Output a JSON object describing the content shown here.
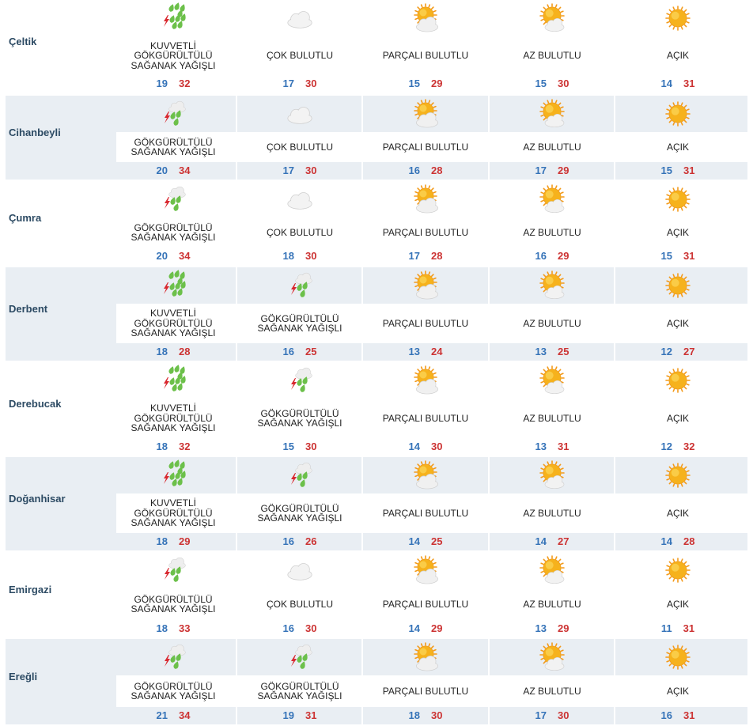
{
  "colors": {
    "row_shade": "#e9eef3",
    "city": "#2c4a63",
    "min_temp": "#3573b8",
    "max_temp": "#cc3333",
    "sun": "#f6b21c",
    "cloud": "#e7e7e7",
    "rain": "#6cc04a",
    "lightning": "#d9282f"
  },
  "rows": [
    {
      "city": "Çeltik",
      "shaded": false,
      "days": [
        {
          "icon": "strong-thunder-shower-icon",
          "condition": "KUVVETLİ GÖKGÜRÜLTÜLÜ SAĞANAK YAĞIŞLI",
          "min": "19",
          "max": "32"
        },
        {
          "icon": "cloudy-icon",
          "condition": "ÇOK BULUTLU",
          "min": "17",
          "max": "30"
        },
        {
          "icon": "partly-cloudy-icon",
          "condition": "PARÇALI BULUTLU",
          "min": "15",
          "max": "29"
        },
        {
          "icon": "mostly-sunny-icon",
          "condition": "AZ BULUTLU",
          "min": "15",
          "max": "30"
        },
        {
          "icon": "sunny-icon",
          "condition": "AÇIK",
          "min": "14",
          "max": "31"
        }
      ]
    },
    {
      "city": "Cihanbeyli",
      "shaded": true,
      "days": [
        {
          "icon": "thunder-shower-icon",
          "condition": "GÖKGÜRÜLTÜLÜ SAĞANAK YAĞIŞLI",
          "min": "20",
          "max": "34"
        },
        {
          "icon": "cloudy-icon",
          "condition": "ÇOK BULUTLU",
          "min": "17",
          "max": "30"
        },
        {
          "icon": "partly-cloudy-icon",
          "condition": "PARÇALI BULUTLU",
          "min": "16",
          "max": "28"
        },
        {
          "icon": "mostly-sunny-icon",
          "condition": "AZ BULUTLU",
          "min": "17",
          "max": "29"
        },
        {
          "icon": "sunny-icon",
          "condition": "AÇIK",
          "min": "15",
          "max": "31"
        }
      ]
    },
    {
      "city": "Çumra",
      "shaded": false,
      "days": [
        {
          "icon": "thunder-shower-icon",
          "condition": "GÖKGÜRÜLTÜLÜ SAĞANAK YAĞIŞLI",
          "min": "20",
          "max": "34"
        },
        {
          "icon": "cloudy-icon",
          "condition": "ÇOK BULUTLU",
          "min": "18",
          "max": "30"
        },
        {
          "icon": "partly-cloudy-icon",
          "condition": "PARÇALI BULUTLU",
          "min": "17",
          "max": "28"
        },
        {
          "icon": "mostly-sunny-icon",
          "condition": "AZ BULUTLU",
          "min": "16",
          "max": "29"
        },
        {
          "icon": "sunny-icon",
          "condition": "AÇIK",
          "min": "15",
          "max": "31"
        }
      ]
    },
    {
      "city": "Derbent",
      "shaded": true,
      "days": [
        {
          "icon": "strong-thunder-shower-icon",
          "condition": "KUVVETLİ GÖKGÜRÜLTÜLÜ SAĞANAK YAĞIŞLI",
          "min": "18",
          "max": "28"
        },
        {
          "icon": "thunder-shower-icon",
          "condition": "GÖKGÜRÜLTÜLÜ SAĞANAK YAĞIŞLI",
          "min": "16",
          "max": "25"
        },
        {
          "icon": "partly-cloudy-icon",
          "condition": "PARÇALI BULUTLU",
          "min": "13",
          "max": "24"
        },
        {
          "icon": "mostly-sunny-icon",
          "condition": "AZ BULUTLU",
          "min": "13",
          "max": "25"
        },
        {
          "icon": "sunny-icon",
          "condition": "AÇIK",
          "min": "12",
          "max": "27"
        }
      ]
    },
    {
      "city": "Derebucak",
      "shaded": false,
      "days": [
        {
          "icon": "strong-thunder-shower-icon",
          "condition": "KUVVETLİ GÖKGÜRÜLTÜLÜ SAĞANAK YAĞIŞLI",
          "min": "18",
          "max": "32"
        },
        {
          "icon": "thunder-shower-icon",
          "condition": "GÖKGÜRÜLTÜLÜ SAĞANAK YAĞIŞLI",
          "min": "15",
          "max": "30"
        },
        {
          "icon": "partly-cloudy-icon",
          "condition": "PARÇALI BULUTLU",
          "min": "14",
          "max": "30"
        },
        {
          "icon": "mostly-sunny-icon",
          "condition": "AZ BULUTLU",
          "min": "13",
          "max": "31"
        },
        {
          "icon": "sunny-icon",
          "condition": "AÇIK",
          "min": "12",
          "max": "32"
        }
      ]
    },
    {
      "city": "Doğanhisar",
      "shaded": true,
      "days": [
        {
          "icon": "strong-thunder-shower-icon",
          "condition": "KUVVETLİ GÖKGÜRÜLTÜLÜ SAĞANAK YAĞIŞLI",
          "min": "18",
          "max": "29"
        },
        {
          "icon": "thunder-shower-icon",
          "condition": "GÖKGÜRÜLTÜLÜ SAĞANAK YAĞIŞLI",
          "min": "16",
          "max": "26"
        },
        {
          "icon": "partly-cloudy-icon",
          "condition": "PARÇALI BULUTLU",
          "min": "14",
          "max": "25"
        },
        {
          "icon": "mostly-sunny-icon",
          "condition": "AZ BULUTLU",
          "min": "14",
          "max": "27"
        },
        {
          "icon": "sunny-icon",
          "condition": "AÇIK",
          "min": "14",
          "max": "28"
        }
      ]
    },
    {
      "city": "Emirgazi",
      "shaded": false,
      "days": [
        {
          "icon": "thunder-shower-icon",
          "condition": "GÖKGÜRÜLTÜLÜ SAĞANAK YAĞIŞLI",
          "min": "18",
          "max": "33"
        },
        {
          "icon": "cloudy-icon",
          "condition": "ÇOK BULUTLU",
          "min": "16",
          "max": "30"
        },
        {
          "icon": "partly-cloudy-icon",
          "condition": "PARÇALI BULUTLU",
          "min": "14",
          "max": "29"
        },
        {
          "icon": "mostly-sunny-icon",
          "condition": "AZ BULUTLU",
          "min": "13",
          "max": "29"
        },
        {
          "icon": "sunny-icon",
          "condition": "AÇIK",
          "min": "11",
          "max": "31"
        }
      ]
    },
    {
      "city": "Ereğli",
      "shaded": true,
      "days": [
        {
          "icon": "thunder-shower-icon",
          "condition": "GÖKGÜRÜLTÜLÜ SAĞANAK YAĞIŞLI",
          "min": "21",
          "max": "34"
        },
        {
          "icon": "thunder-shower-icon",
          "condition": "GÖKGÜRÜLTÜLÜ SAĞANAK YAĞIŞLI",
          "min": "19",
          "max": "31"
        },
        {
          "icon": "partly-cloudy-icon",
          "condition": "PARÇALI BULUTLU",
          "min": "18",
          "max": "30"
        },
        {
          "icon": "mostly-sunny-icon",
          "condition": "AZ BULUTLU",
          "min": "17",
          "max": "30"
        },
        {
          "icon": "sunny-icon",
          "condition": "AÇIK",
          "min": "16",
          "max": "31"
        }
      ]
    }
  ]
}
